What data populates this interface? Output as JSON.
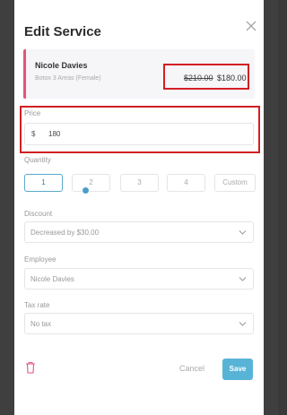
{
  "modal": {
    "title": "Edit Service",
    "close_icon": "close-icon"
  },
  "service": {
    "name": "Nicole Davies",
    "description": "Botox 3 Areas (Female)",
    "original_price": "$210.00",
    "new_price": "$180.00",
    "accent_color": "#e0567b"
  },
  "price": {
    "label": "Price",
    "currency": "$",
    "value": "180"
  },
  "quantity": {
    "label": "Quantity",
    "options": [
      "1",
      "2",
      "3",
      "4",
      "Custom"
    ],
    "selected": "1"
  },
  "discount": {
    "label": "Discount",
    "selected": "Decreased by $30.00"
  },
  "employee": {
    "label": "Employee",
    "selected": "Nicole Davies"
  },
  "tax": {
    "label": "Tax rate",
    "selected": "No tax"
  },
  "actions": {
    "delete_icon": "trash-icon",
    "cancel_label": "Cancel",
    "save_label": "Save",
    "save_color": "#58b4d6"
  },
  "highlight_color": "#d21f24"
}
